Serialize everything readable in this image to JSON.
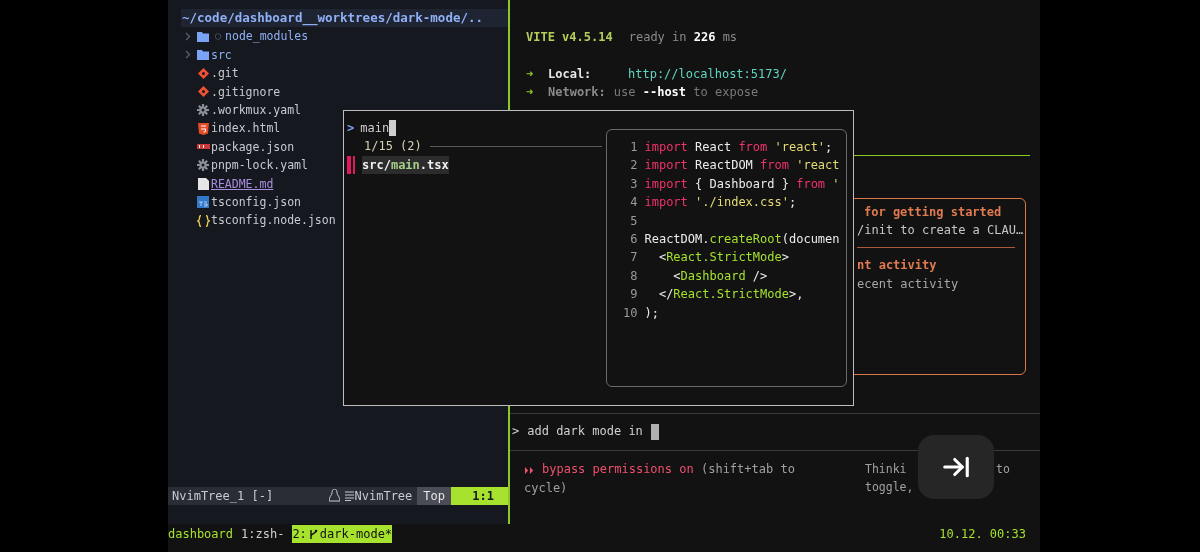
{
  "file_tree": {
    "path": "~/code/dashboard__worktrees/dark-mode/..",
    "items": [
      {
        "name": "node_modules",
        "kind": "folder",
        "marker": "○",
        "modified": false
      },
      {
        "name": "src",
        "kind": "folder",
        "modified": false
      },
      {
        "name": ".git",
        "kind": "git",
        "modified": false
      },
      {
        "name": ".gitignore",
        "kind": "git",
        "modified": false
      },
      {
        "name": ".workmux.yaml",
        "kind": "config",
        "modified": false
      },
      {
        "name": "index.html",
        "kind": "html",
        "modified": false
      },
      {
        "name": "package.json",
        "kind": "npm",
        "modified": false
      },
      {
        "name": "pnpm-lock.yaml",
        "kind": "config",
        "modified": false
      },
      {
        "name": "README.md",
        "kind": "doc",
        "modified": true
      },
      {
        "name": "tsconfig.json",
        "kind": "ts",
        "modified": false
      },
      {
        "name": "tsconfig.node.json",
        "kind": "json",
        "modified": false
      }
    ]
  },
  "nvim_status": {
    "buffer": "NvimTree_1 [-]",
    "filetype": "NvimTree",
    "position": "Top",
    "cursor": "1:1"
  },
  "dev_server": {
    "name": "VITE v4.5.14",
    "ready": "ready in **226** ms",
    "arrow": "➜",
    "local_label": "Local:",
    "local_url": "http://localhost:5173/",
    "network_label": "Network:",
    "network_text": "use **--host** to expose"
  },
  "welcome_box": {
    "tips_title": "for getting started",
    "tips_text": "/init to create a CLAU…",
    "activity_title": "nt activity",
    "activity_text": "ecent activity"
  },
  "prompt": {
    "marker": ">",
    "value": "add dark mode in"
  },
  "mode_status": {
    "icon": "⏵⏵",
    "label": "bypass permissions on",
    "hint": "(shift+tab to cycle)",
    "thinking_a": "Thinki",
    "thinking_b": "to",
    "thinking_c": "toggle,"
  },
  "finder": {
    "prompt": ">",
    "query": "main",
    "count": "1/15 (2)",
    "results": [
      {
        "dir": "src/",
        "match": "main",
        "rest": ".tsx",
        "selected": true
      }
    ],
    "preview": [
      {
        "n": "1",
        "tokens": [
          {
            "t": "import",
            "kind": "kw"
          },
          {
            "t": " React ",
            "kind": "plain"
          },
          {
            "t": "from",
            "kind": "kw"
          },
          {
            "t": " 'react'",
            "kind": "str"
          },
          {
            "t": ";",
            "kind": "plain"
          }
        ]
      },
      {
        "n": "2",
        "tokens": [
          {
            "t": "import",
            "kind": "kw"
          },
          {
            "t": " ReactDOM ",
            "kind": "plain"
          },
          {
            "t": "from",
            "kind": "kw"
          },
          {
            "t": " 'react",
            "kind": "str"
          }
        ]
      },
      {
        "n": "3",
        "tokens": [
          {
            "t": "import",
            "kind": "kw"
          },
          {
            "t": " { Dashboard } ",
            "kind": "plain"
          },
          {
            "t": "from",
            "kind": "kw"
          },
          {
            "t": " '",
            "kind": "str"
          }
        ]
      },
      {
        "n": "4",
        "tokens": [
          {
            "t": "import",
            "kind": "kw"
          },
          {
            "t": " './index.css'",
            "kind": "str"
          },
          {
            "t": ";",
            "kind": "plain"
          }
        ]
      },
      {
        "n": "5"
      },
      {
        "n": "6",
        "tokens": [
          {
            "t": "ReactDOM.",
            "kind": "plain"
          },
          {
            "t": "createRoot",
            "kind": "fn"
          },
          {
            "t": "(documen",
            "kind": "plain"
          }
        ]
      },
      {
        "n": "7",
        "tokens": [
          {
            "t": "  <",
            "kind": "plain"
          },
          {
            "t": "React.StrictMode",
            "kind": "fn"
          },
          {
            "t": ">",
            "kind": "plain"
          }
        ]
      },
      {
        "n": "8",
        "tokens": [
          {
            "t": "    <",
            "kind": "plain"
          },
          {
            "t": "Dashboard",
            "kind": "fn"
          },
          {
            "t": " />",
            "kind": "plain"
          }
        ]
      },
      {
        "n": "9",
        "tokens": [
          {
            "t": "  </",
            "kind": "plain"
          },
          {
            "t": "React.StrictMode",
            "kind": "fn"
          },
          {
            "t": ">,",
            "kind": "plain"
          }
        ]
      },
      {
        "n": "10",
        "tokens": [
          {
            "t": ");",
            "kind": "plain"
          }
        ]
      }
    ]
  },
  "tmux": {
    "session": "dashboard",
    "windows": [
      {
        "label": "1:zsh-",
        "selected": false
      },
      {
        "label": "2:",
        "branch": "dark-mode*",
        "selected": true
      }
    ],
    "clock": "10.12. 00:33"
  }
}
